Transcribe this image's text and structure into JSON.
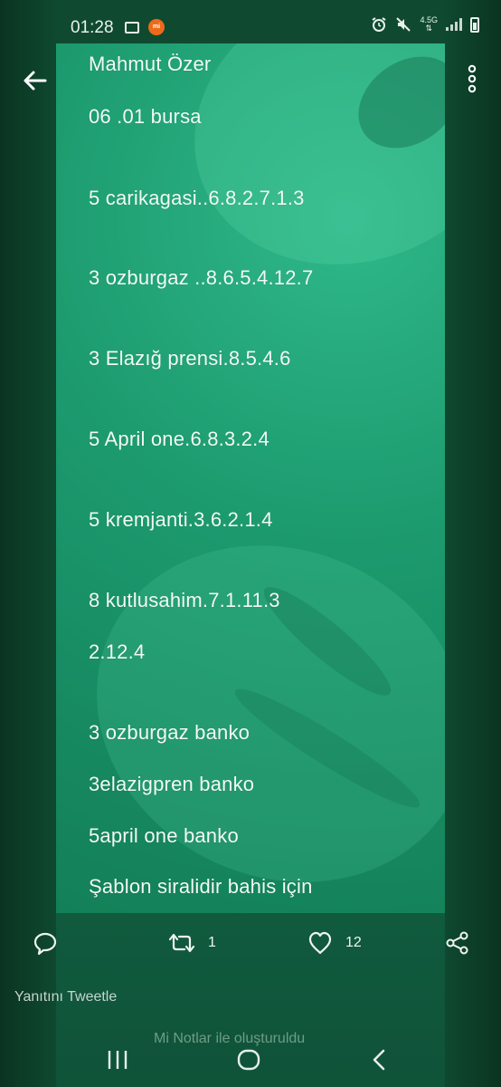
{
  "status_bar": {
    "time": "01:28",
    "network": "4.5G",
    "icons": [
      "gallery-icon",
      "mi-app-icon",
      "alarm-icon",
      "mute-icon",
      "signal-icon",
      "battery-icon"
    ]
  },
  "app_bar": {
    "back_icon": "arrow-left-icon",
    "more_icon": "more-vertical-icon"
  },
  "note": {
    "lines": [
      "Mahmut Özer",
      "06 .01 bursa",
      "5 carikagasi..6.8.2.7.1.3",
      "3 ozburgaz ..8.6.5.4.12.7",
      "3 Elazığ prensi.8.5.4.6",
      "5 April one.6.8.3.2.4",
      "5 kremjanti.3.6.2.1.4",
      "8 kutlusahim.7.1.11.3",
      "2.12.4",
      "3 ozburgaz banko",
      "3elazigpren banko",
      "5april one banko",
      "Şablon siralidir bahis için"
    ],
    "watermark": "Mi Notlar ile oluşturuldu"
  },
  "actions": {
    "retweet_count": "1",
    "like_count": "12"
  },
  "reply": {
    "placeholder": "Yanıtını Tweetle"
  },
  "colors": {
    "panel_green": "#1d9c70",
    "dark_green": "#0f4a30",
    "text": "#f2faf6"
  }
}
